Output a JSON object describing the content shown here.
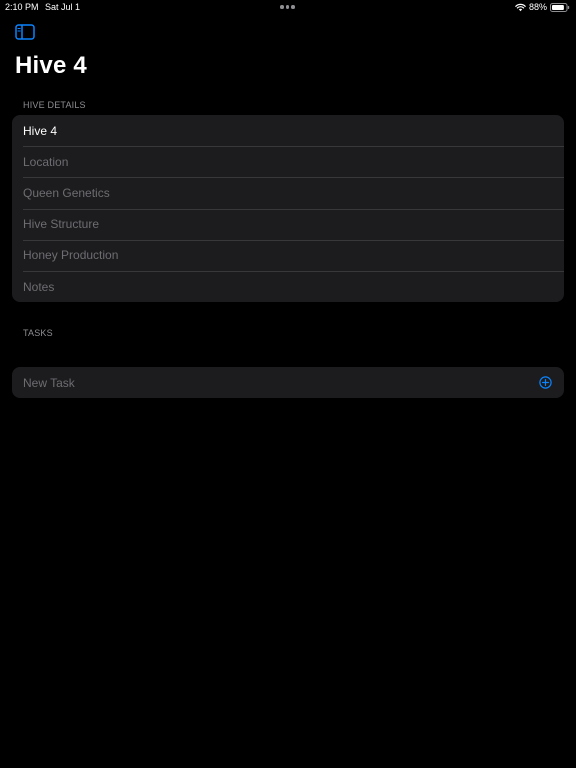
{
  "status_bar": {
    "time": "2:10 PM",
    "date": "Sat Jul 1",
    "battery_percent": "88%",
    "battery_level": 0.88,
    "icons": [
      "multitasking-dots-icon",
      "wifi-icon",
      "battery-icon"
    ]
  },
  "toolbar": {
    "sidebar_icon": "sidebar-icon"
  },
  "page": {
    "title": "Hive 4"
  },
  "hive_details": {
    "header": "HIVE DETAILS",
    "fields": {
      "name_value": "Hive 4",
      "location_placeholder": "Location",
      "queen_genetics_placeholder": "Queen Genetics",
      "hive_structure_placeholder": "Hive Structure",
      "honey_production_placeholder": "Honey Production",
      "notes_placeholder": "Notes"
    }
  },
  "tasks": {
    "header": "TASKS",
    "new_task_placeholder": "New Task",
    "add_icon": "plus-circle-icon"
  },
  "colors": {
    "background": "#000000",
    "card": "#1c1c1e",
    "separator": "#38383a",
    "accent": "#0a84ff",
    "secondary_text": "#8e8e93",
    "placeholder_text": "#6d6d72"
  }
}
